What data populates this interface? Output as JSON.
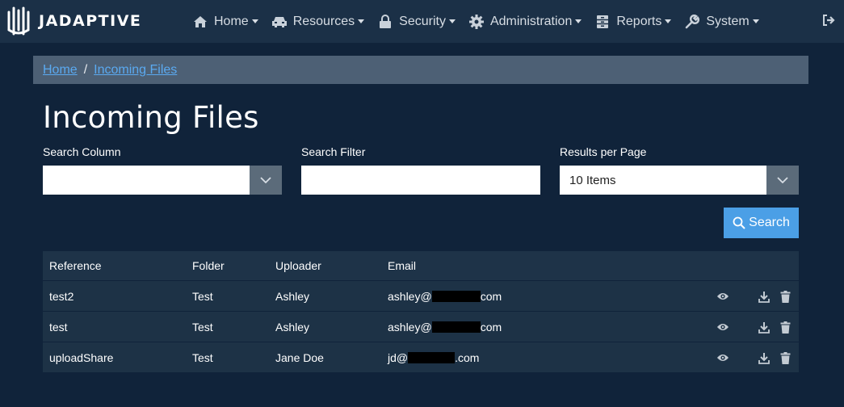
{
  "brand": {
    "name": "JADAPTIVE"
  },
  "nav": {
    "items": [
      {
        "label": "Home",
        "icon": "home-icon"
      },
      {
        "label": "Resources",
        "icon": "car-icon"
      },
      {
        "label": "Security",
        "icon": "lock-icon"
      },
      {
        "label": "Administration",
        "icon": "gear-icon"
      },
      {
        "label": "Reports",
        "icon": "archive-icon"
      },
      {
        "label": "System",
        "icon": "wrench-icon"
      }
    ],
    "logout_icon": "sign-out-icon"
  },
  "breadcrumb": {
    "home": "Home",
    "separator": "/",
    "current": "Incoming Files"
  },
  "page": {
    "title": "Incoming Files"
  },
  "filters": {
    "search_column": {
      "label": "Search Column",
      "value": ""
    },
    "search_filter": {
      "label": "Search Filter",
      "value": ""
    },
    "results_per_page": {
      "label": "Results per Page",
      "value": "10 Items"
    },
    "search_button": "Search"
  },
  "table": {
    "headers": {
      "reference": "Reference",
      "folder": "Folder",
      "uploader": "Uploader",
      "email": "Email"
    },
    "rows": [
      {
        "reference": "test2",
        "folder": "Test",
        "uploader": "Ashley",
        "email_prefix": "ashley@",
        "email_suffix": "com"
      },
      {
        "reference": "test",
        "folder": "Test",
        "uploader": "Ashley",
        "email_prefix": "ashley@",
        "email_suffix": "com"
      },
      {
        "reference": "uploadShare",
        "folder": "Test",
        "uploader": "Jane Doe",
        "email_prefix": "jd@",
        "email_suffix": ".com"
      }
    ]
  },
  "colors": {
    "background": "#10233a",
    "navbar": "#1b3047",
    "breadcrumb": "#4d6075",
    "link": "#5aa9f0",
    "primary_button": "#4b9fe6",
    "table_row": "#1d3246"
  }
}
